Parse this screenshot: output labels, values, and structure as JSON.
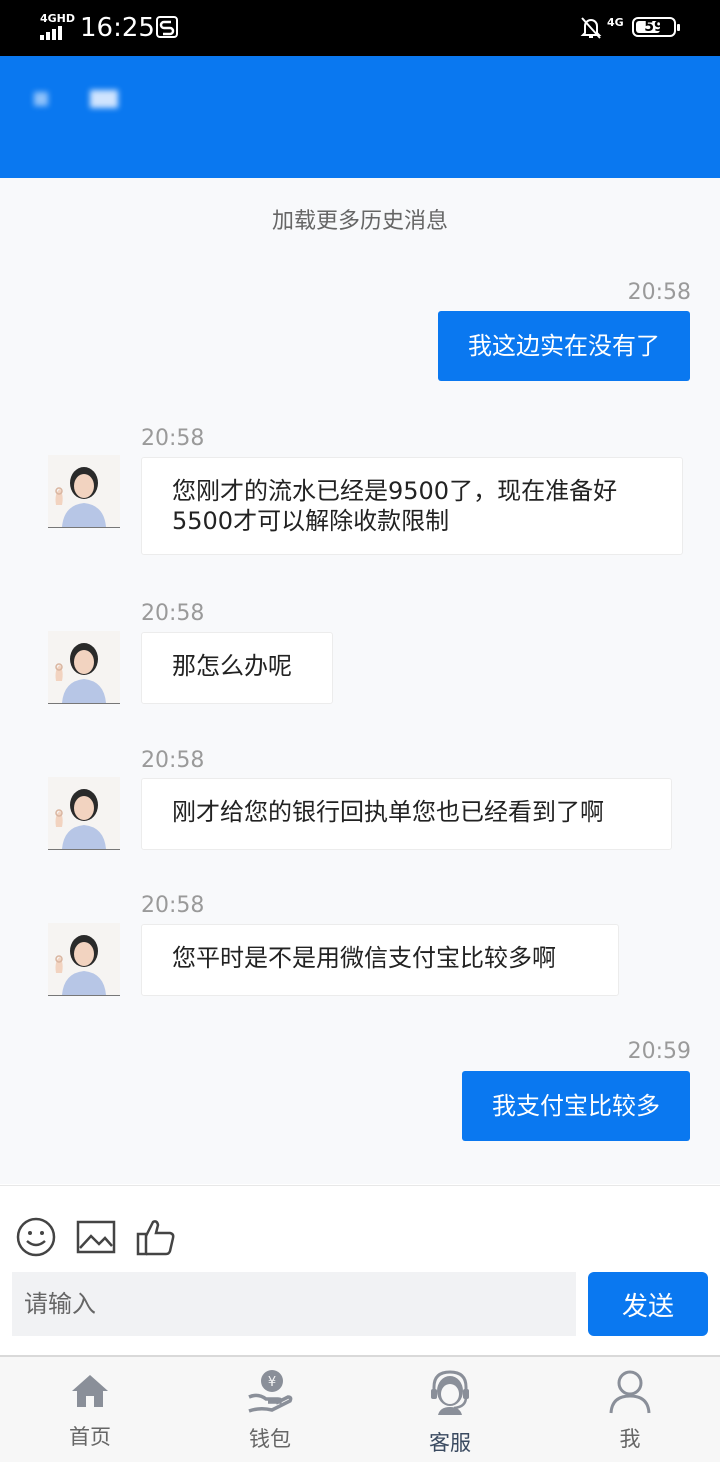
{
  "status_bar": {
    "network": "4GHD",
    "time": "16:25",
    "network2": "4G",
    "battery": "59"
  },
  "chat": {
    "load_more": "加载更多历史消息",
    "messages": [
      {
        "from": "me",
        "time": "20:58",
        "text": "我这边实在没有了"
      },
      {
        "from": "agent",
        "time": "20:58",
        "text": "您刚才的流水已经是9500了，现在准备好5500才可以解除收款限制"
      },
      {
        "from": "agent",
        "time": "20:58",
        "text": "那怎么办呢"
      },
      {
        "from": "agent",
        "time": "20:58",
        "text": "刚才给您的银行回执单您也已经看到了啊"
      },
      {
        "from": "agent",
        "time": "20:58",
        "text": "您平时是不是用微信支付宝比较多啊"
      },
      {
        "from": "me",
        "time": "20:59",
        "text": "我支付宝比较多"
      }
    ]
  },
  "composer": {
    "tools": [
      "emoji-icon",
      "image-icon",
      "thumbs-up-icon"
    ],
    "placeholder": "请输入",
    "send_label": "发送"
  },
  "nav": {
    "items": [
      {
        "label": "首页",
        "icon": "home-icon"
      },
      {
        "label": "钱包",
        "icon": "wallet-icon"
      },
      {
        "label": "客服",
        "icon": "customer-service-icon"
      },
      {
        "label": "我",
        "icon": "profile-icon"
      }
    ],
    "active": "客服"
  },
  "colors": {
    "brand": "#0a78f0",
    "chat_bg": "#f8f9fb",
    "timestamp": "#9a9a9a"
  }
}
